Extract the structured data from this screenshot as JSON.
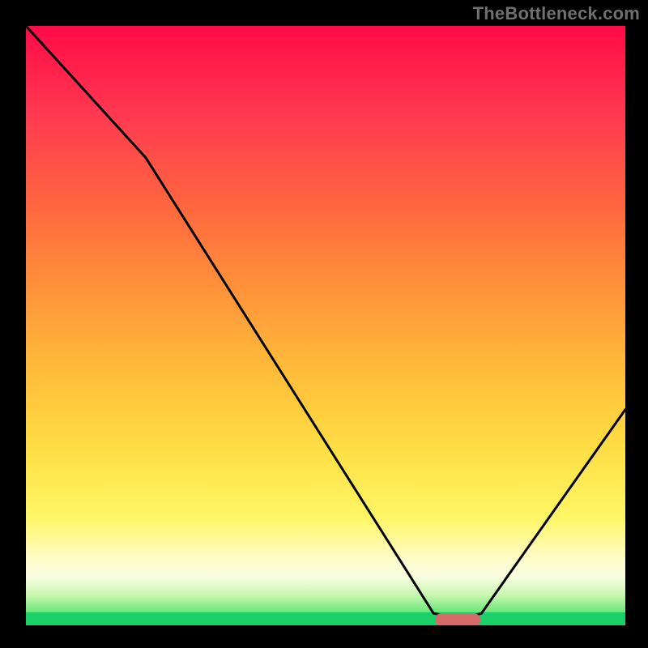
{
  "watermark": "TheBottleneck.com",
  "colors": {
    "frame_bg": "#000000",
    "curve_stroke": "#000000",
    "marker_fill": "#d76a6b",
    "green": "#1ad168",
    "top_red": "#ff0a46"
  },
  "chart_data": {
    "type": "line",
    "title": "",
    "xlabel": "",
    "ylabel": "",
    "xlim": [
      0,
      100
    ],
    "ylim": [
      0,
      100
    ],
    "grid": false,
    "legend_position": "none",
    "series": [
      {
        "name": "curve",
        "x": [
          0,
          20,
          68,
          73,
          76,
          100
        ],
        "y": [
          100,
          78,
          2,
          1,
          2,
          36
        ]
      }
    ],
    "marker": {
      "x": 72,
      "y": 1
    },
    "background_gradient": {
      "direction": "vertical",
      "stops": [
        {
          "y": 100,
          "color": "#ff0a46"
        },
        {
          "y": 50,
          "color": "#ff963a"
        },
        {
          "y": 18,
          "color": "#fff766"
        },
        {
          "y": 8,
          "color": "#f7fee0"
        },
        {
          "y": 0,
          "color": "#1ad168"
        }
      ]
    }
  }
}
